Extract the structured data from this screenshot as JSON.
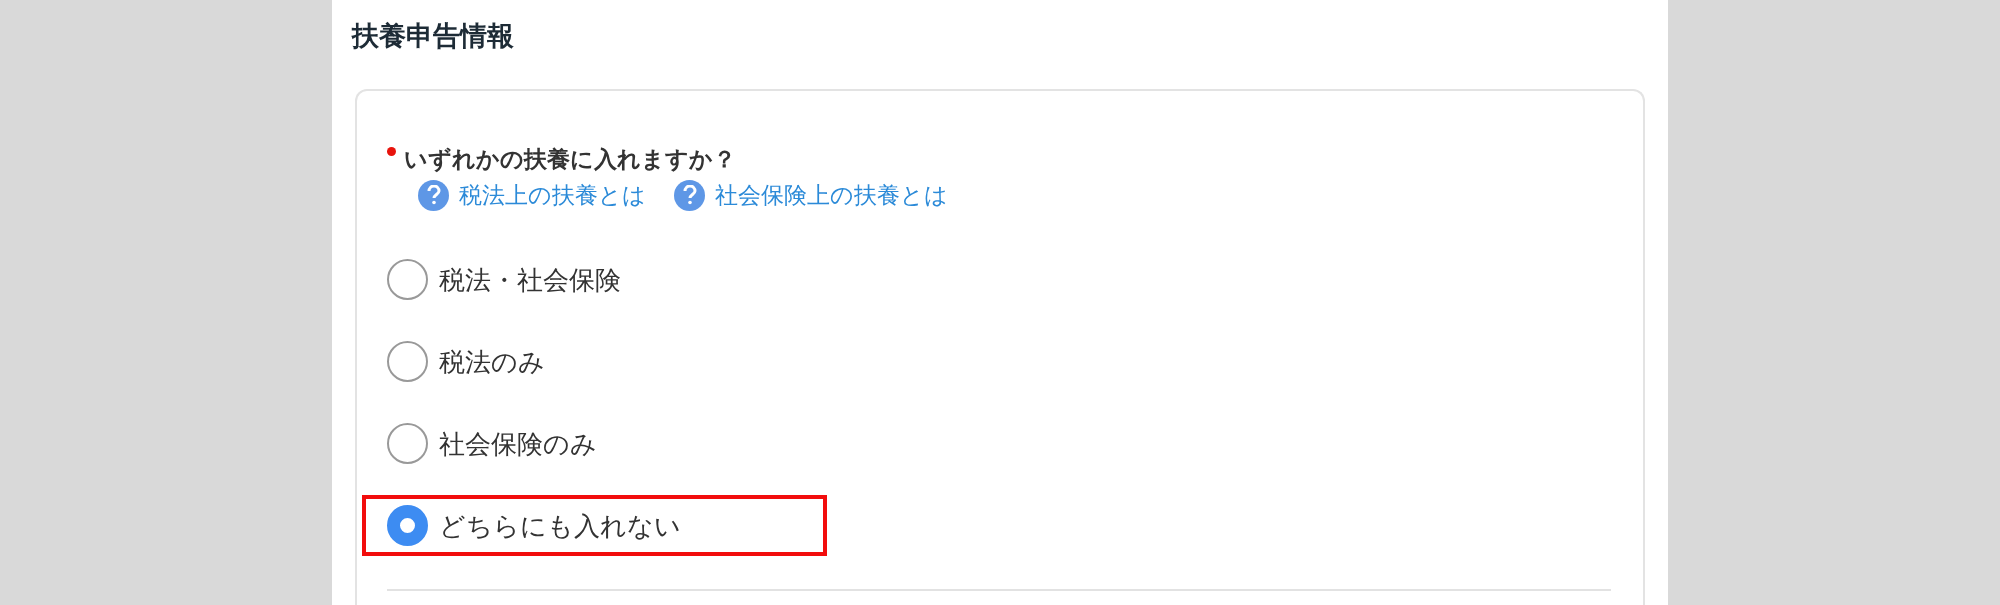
{
  "section_title": "扶養申告情報",
  "question": {
    "label": "いずれかの扶養に入れますか？",
    "required": true
  },
  "help_links": [
    {
      "label": "税法上の扶養とは"
    },
    {
      "label": "社会保険上の扶養とは"
    }
  ],
  "options": [
    {
      "label": "税法・社会保険",
      "selected": false,
      "highlighted": false
    },
    {
      "label": "税法のみ",
      "selected": false,
      "highlighted": false
    },
    {
      "label": "社会保険のみ",
      "selected": false,
      "highlighted": false
    },
    {
      "label": "どちらにも入れない",
      "selected": true,
      "highlighted": true
    }
  ]
}
